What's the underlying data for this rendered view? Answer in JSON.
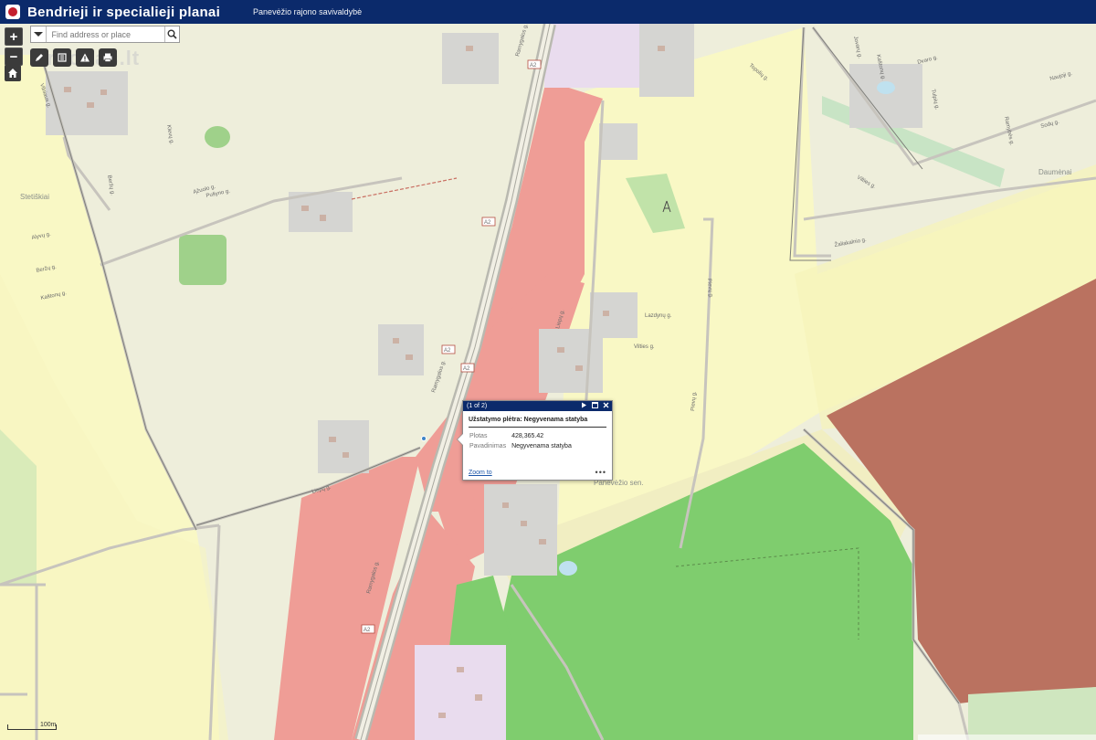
{
  "header": {
    "title": "Bendrieji ir specialieji planai",
    "subtitle": "Panevėžio rajono savivaldybė"
  },
  "search": {
    "placeholder": "Find address or place"
  },
  "zoom": {
    "in_label": "+",
    "out_label": "−"
  },
  "watermark": "aruodas.lt",
  "popup": {
    "counter": "(1 of 2)",
    "title": "Užstatymo plėtra: Negyvenama statyba",
    "fields": [
      {
        "key": "Plotas",
        "value": "428,365.42"
      },
      {
        "key": "Pavadinimas",
        "value": "Negyvenama statyba"
      }
    ],
    "zoom_to": "Zoom to",
    "more": "•••"
  },
  "map_labels": {
    "places": [
      "Stetiškiai",
      "Daumėnai",
      "Panevėžio sen."
    ],
    "roads": [
      "Vilniaus g.",
      "Pušyno g.",
      "Ramygalos g.",
      "Alyvų g.",
      "Beržų g.",
      "Kaštonų g.",
      "Ramygalos g.",
      "Liepų g.",
      "Vilties g.",
      "Ramygalos g.",
      "Topolių g.",
      "Lazdynų g.",
      "Klevų g.",
      "Beržų g.",
      "Ąžuolo g.",
      "Liepų g.",
      "Pievų g.",
      "Pievų g.",
      "Jovarų g.",
      "Kaštonų g.",
      "Dvaro g.",
      "Ramybės g.",
      "Sodų g.",
      "Tulpių g.",
      "Naujoji g.",
      "Vilties g.",
      "Žaliakalnio g."
    ],
    "route": [
      "A2",
      "A2",
      "A2",
      "A2",
      "A2"
    ]
  },
  "scale": {
    "label": "100m"
  },
  "colors": {
    "header_bg": "#0b2a6b",
    "industrial_red": "#ef9d96",
    "residential_yellow": "#f9f8c5",
    "greenery": "#7fcd6e",
    "brown_zone": "#ba7260"
  }
}
